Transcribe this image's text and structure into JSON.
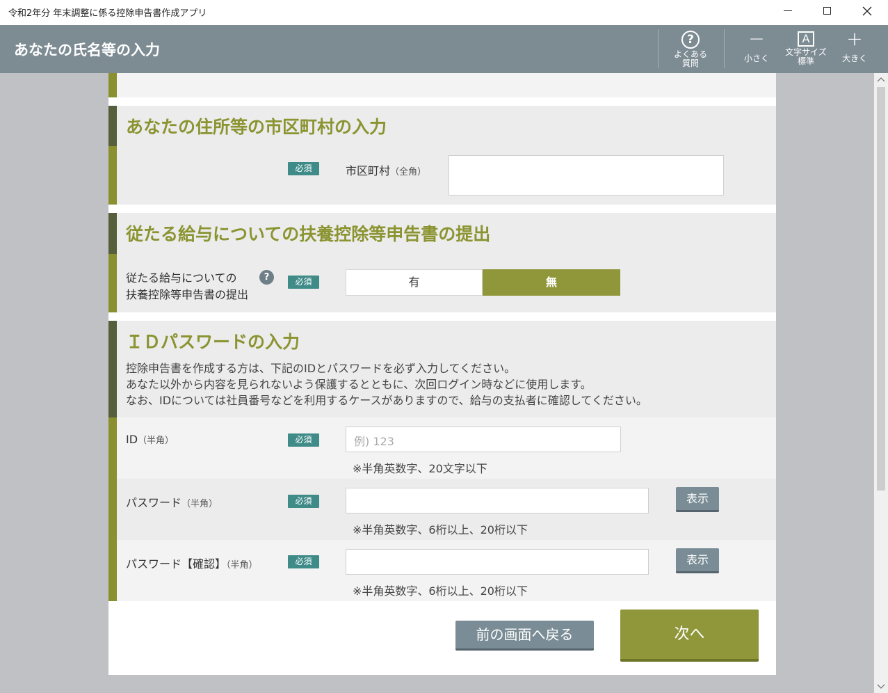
{
  "window": {
    "title": "令和2年分 年末調整に係る控除申告書作成アプリ",
    "minimize_icon": "minimize-icon",
    "maximize_icon": "maximize-icon",
    "close_icon": "close-icon"
  },
  "header": {
    "title": "あなたの氏名等の入力",
    "faq_line1": "よくある",
    "faq_line2": "質問",
    "smaller_label": "小さく",
    "fontsize_line1": "文字サイズ",
    "fontsize_line2": "標準",
    "larger_label": "大きく",
    "faq_icon": "?",
    "fontsize_icon": "A",
    "minus_icon": "−",
    "plus_icon": "+"
  },
  "sections": {
    "address": {
      "title": "あなたの住所等の市区町村の入力",
      "required": "必須",
      "label": "市区町村",
      "label_note": "（全角）",
      "value": ""
    },
    "dependent": {
      "title": "従たる給与についての扶養控除等申告書の提出",
      "label_line1": "従たる給与についての",
      "label_line2": "扶養控除等申告書の提出",
      "help_icon": "?",
      "required": "必須",
      "option_yes": "有",
      "option_no": "無",
      "selected": "無"
    },
    "idpass": {
      "title": "ＩＤパスワードの入力",
      "desc1": "控除申告書を作成する方は、下記のIDとパスワードを必ず入力してください。",
      "desc2": "あなた以外から内容を見られないよう保護するとともに、次回ログイン時などに使用します。",
      "desc3": "なお、IDについては社員番号などを利用するケースがありますので、給与の支払者に確認してください。",
      "id_label": "ID",
      "id_note": "（半角）",
      "id_required": "必須",
      "id_placeholder": "例) 123",
      "id_hint": "※半角英数字、20文字以下",
      "pw_label": "パスワード",
      "pw_note": "（半角）",
      "pw_required": "必須",
      "pw_hint": "※半角英数字、6桁以上、20桁以下",
      "pw_show": "表示",
      "pwc_label": "パスワード【確認】",
      "pwc_note": "（半角）",
      "pwc_required": "必須",
      "pwc_hint": "※半角英数字、6桁以上、20桁以下",
      "pwc_show": "表示"
    }
  },
  "footer": {
    "back": "前の画面へ戻る",
    "next": "次へ"
  },
  "colors": {
    "accent": "#8b9431",
    "header": "#7d8b93",
    "badge": "#3f8b88"
  }
}
